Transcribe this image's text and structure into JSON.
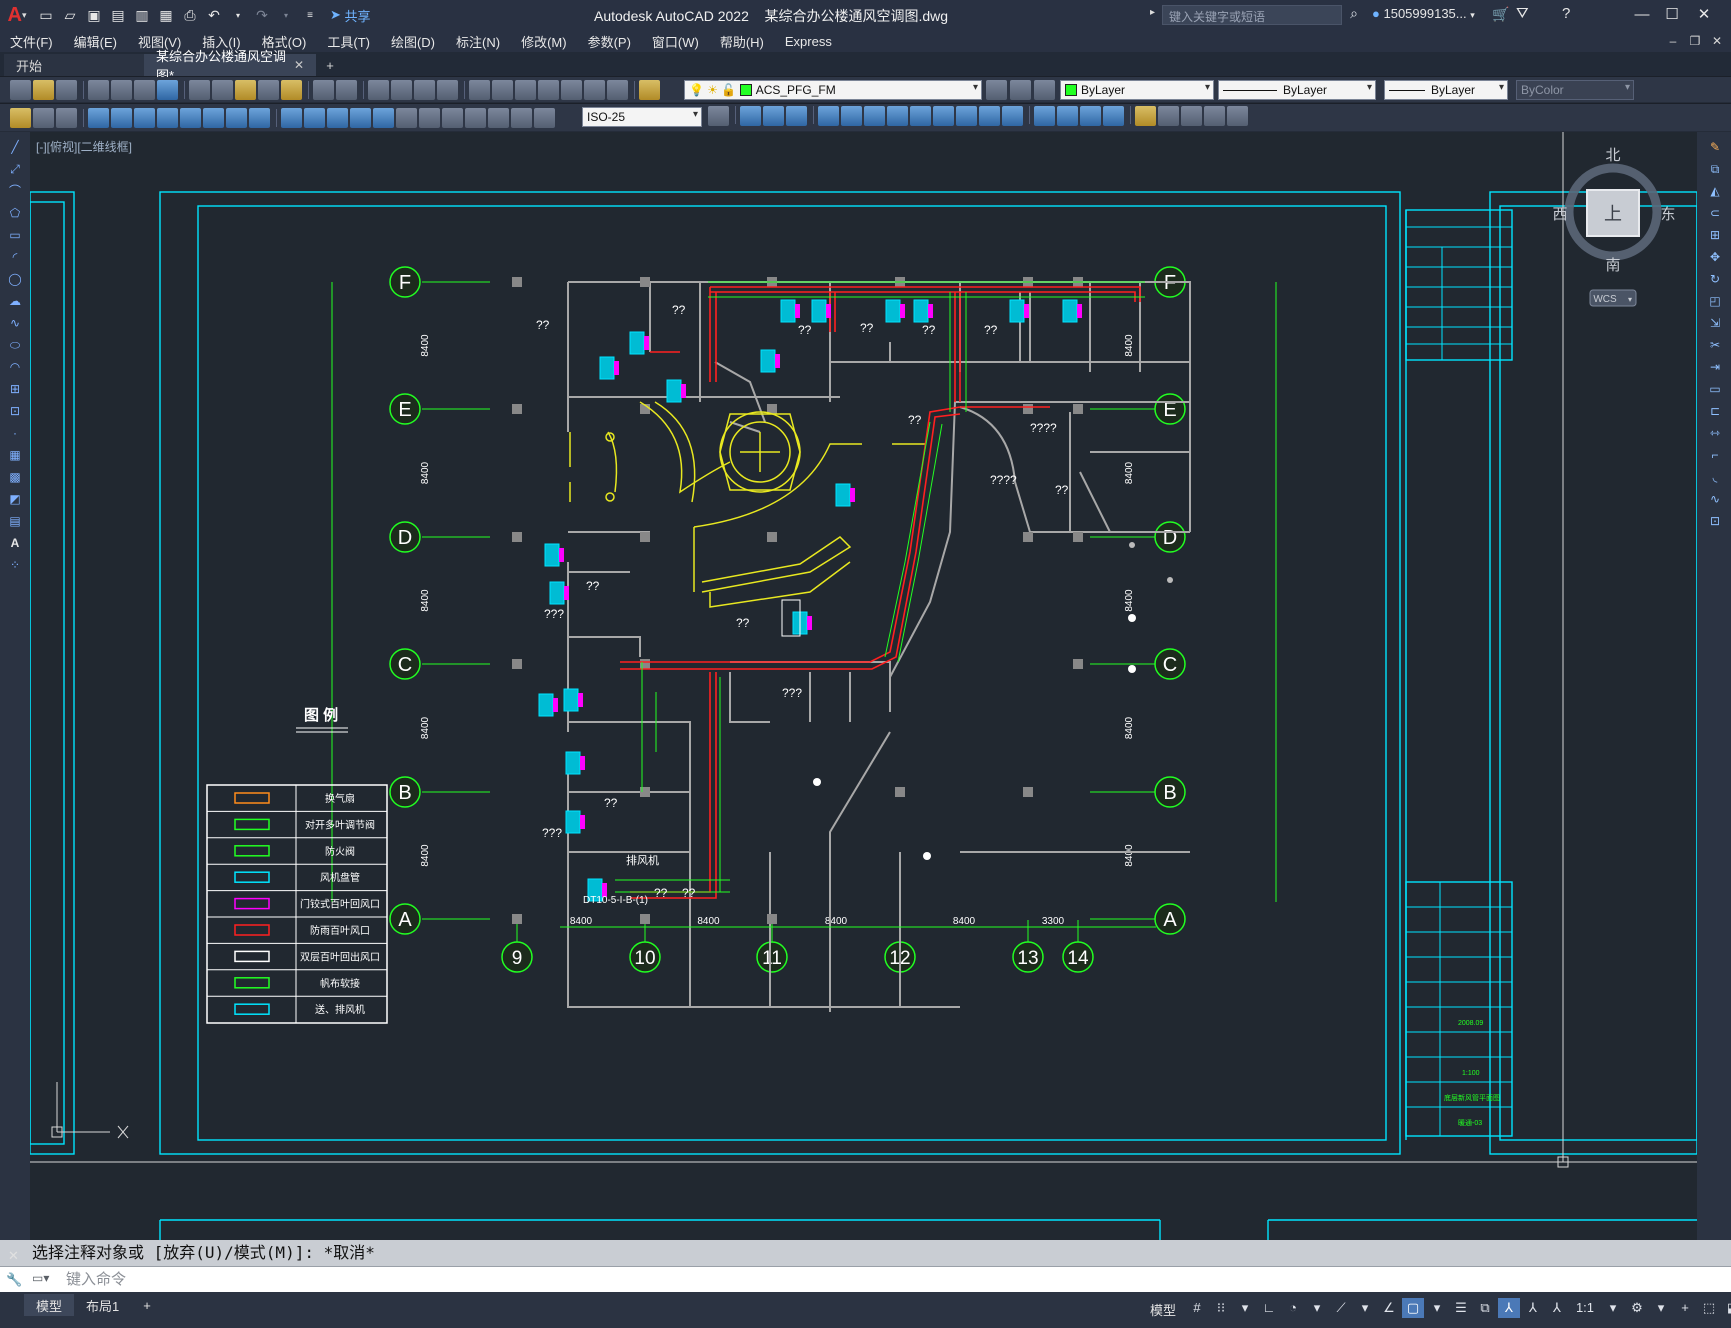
{
  "titlebar": {
    "share_label": "共享",
    "title": "Autodesk AutoCAD 2022    某综合办公楼通风空调图.dwg",
    "search_placeholder": "键入关键字或短语",
    "user": "1505999135..."
  },
  "menubar": {
    "items": [
      "文件(F)",
      "编辑(E)",
      "视图(V)",
      "插入(I)",
      "格式(O)",
      "工具(T)",
      "绘图(D)",
      "标注(N)",
      "修改(M)",
      "参数(P)",
      "窗口(W)",
      "帮助(H)",
      "Express"
    ]
  },
  "tabs": {
    "start": "开始",
    "active": "某综合办公楼通风空调图*"
  },
  "toolbar": {
    "layer": "ACS_PFG_FM",
    "color": "ByLayer",
    "linetype": "ByLayer",
    "lineweight": "ByLayer",
    "plotstyle": "ByColor",
    "dimstyle": "ISO-25"
  },
  "viewport": {
    "label": "[-][俯视][二维线框]"
  },
  "viewcube": {
    "north": "北",
    "south": "南",
    "east": "东",
    "west": "西",
    "face": "上",
    "wcs": "WCS"
  },
  "drawing": {
    "axes_h": [
      "F",
      "E",
      "D",
      "C",
      "B",
      "A"
    ],
    "axes_v": [
      "9",
      "10",
      "11",
      "12",
      "13",
      "14"
    ],
    "dims_h": [
      "8400",
      "8400",
      "8400",
      "8400",
      "3300"
    ],
    "dims_v": [
      "8400",
      "8400",
      "8400",
      "8400",
      "8400"
    ],
    "rooms": [
      "??",
      "??",
      "??",
      "??",
      "??",
      "??",
      "??",
      "????",
      "????",
      "??",
      "??",
      "???",
      "??",
      "???",
      "??",
      "???",
      "??",
      "??"
    ],
    "labels": {
      "exhaust": "排风机",
      "model_tag": "DT10-5-I-B-(1)"
    },
    "title_block": {
      "date": "2008.09",
      "scale": "1:100",
      "drawing_name": "底层新风管平面图",
      "drawing_no": "暖通-03"
    }
  },
  "legend": {
    "title": "图  例",
    "items": [
      "换气扇",
      "对开多叶调节阀",
      "防火阀",
      "风机盘管",
      "门铰式百叶回风口",
      "防雨百叶风口",
      "双层百叶回出风口",
      "帆布软接",
      "送、排风机"
    ]
  },
  "command": {
    "history": "选择注释对象或 [放弃(U)/模式(M)]: *取消*",
    "placeholder": "键入命令"
  },
  "statusbar": {
    "layout_tabs": [
      "模型",
      "布局1"
    ],
    "model_label": "模型",
    "scale": "1:1"
  },
  "colors": {
    "cyan": "#00e5ff",
    "green": "#22ff22",
    "red": "#ff2020",
    "yellow": "#e8e820",
    "magenta": "#ff00ff",
    "wall": "#a8a8a8"
  }
}
